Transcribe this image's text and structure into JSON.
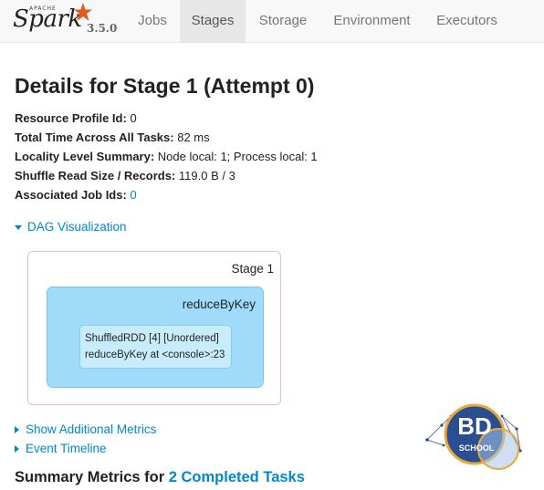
{
  "navbar": {
    "brand_apache": "APACHE",
    "brand_name": "Spark",
    "version": "3.5.0",
    "tabs": [
      {
        "label": "Jobs",
        "active": false
      },
      {
        "label": "Stages",
        "active": true
      },
      {
        "label": "Storage",
        "active": false
      },
      {
        "label": "Environment",
        "active": false
      },
      {
        "label": "Executors",
        "active": false
      }
    ]
  },
  "page": {
    "title": "Details for Stage 1 (Attempt 0)",
    "details": [
      {
        "label": "Resource Profile Id:",
        "value": "0"
      },
      {
        "label": "Total Time Across All Tasks:",
        "value": "82 ms"
      },
      {
        "label": "Locality Level Summary:",
        "value": "Node local: 1; Process local: 1"
      },
      {
        "label": "Shuffle Read Size / Records:",
        "value": "119.0 B / 3"
      },
      {
        "label": "Associated Job Ids:",
        "value": "0"
      }
    ],
    "dag_toggle": "DAG Visualization",
    "dag": {
      "stage_label": "Stage 1",
      "cluster_label": "reduceByKey",
      "node_lines": [
        "ShuffledRDD [4] [Unordered]",
        "reduceByKey at <console>:23"
      ]
    },
    "additional_metrics": "Show Additional Metrics",
    "event_timeline": "Event Timeline",
    "summary_prefix": "Summary Metrics for ",
    "summary_link": "2 Completed Tasks"
  },
  "logo": {
    "line1": "BD",
    "line2": "SCHOOL"
  },
  "colors": {
    "link": "#0088cc",
    "dag_cluster": "#a0dcfa",
    "dag_stage_border": "#f1b9c5",
    "logo_blue": "#2a4e8f",
    "logo_gold": "#e8a83a"
  }
}
